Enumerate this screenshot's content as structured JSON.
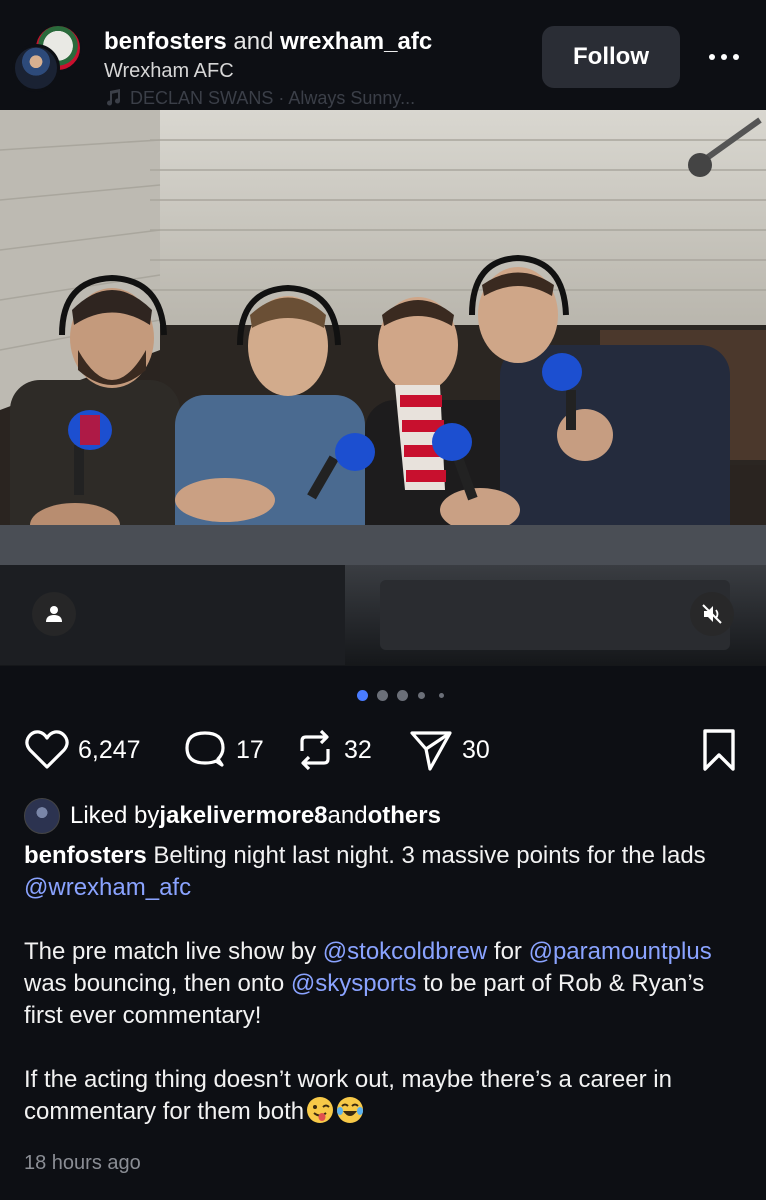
{
  "header": {
    "user1": "benfosters",
    "joiner": " and ",
    "user2": "wrexham_afc",
    "subtitle": "Wrexham AFC",
    "music_note_icon": "music-note-icon",
    "music": "DECLAN SWANS · Always Sunny...",
    "follow_label": "Follow",
    "more_icon": "more-horizontal-icon"
  },
  "media": {
    "description_icon_user": "person-icon",
    "description_icon_mute": "speaker-muted-icon",
    "carousel_count": 5,
    "carousel_active": 0
  },
  "actions": {
    "likes": "6,247",
    "comments": "17",
    "reposts": "32",
    "shares": "30",
    "icons": [
      "heart-icon",
      "comment-icon",
      "repost-icon",
      "send-icon",
      "bookmark-icon"
    ]
  },
  "liked_by": {
    "prefix": "Liked by ",
    "user": "jakelivermore8",
    "middle": " and ",
    "others": "others"
  },
  "caption": {
    "author": "benfosters",
    "p1_text": " Belting night last night. 3 massive points for the lads ",
    "p1_mention": "@wrexham_afc",
    "p2_a": "The pre match live show by ",
    "p2_m1": "@stokcoldbrew",
    "p2_b": " for ",
    "p2_m2": "@paramountplus",
    "p2_c": " was bouncing, then onto ",
    "p2_m3": "@skysports",
    "p2_d": " to be part of Rob & Ryan’s first ever commentary!",
    "p3": "If the acting thing doesn’t work out, maybe there’s a career in commentary for them both"
  },
  "timestamp": "18 hours ago",
  "colors": {
    "background": "#0d0f14",
    "mention": "#8aa3ff",
    "active_dot": "#4a7cff",
    "button": "#2a2d35"
  }
}
